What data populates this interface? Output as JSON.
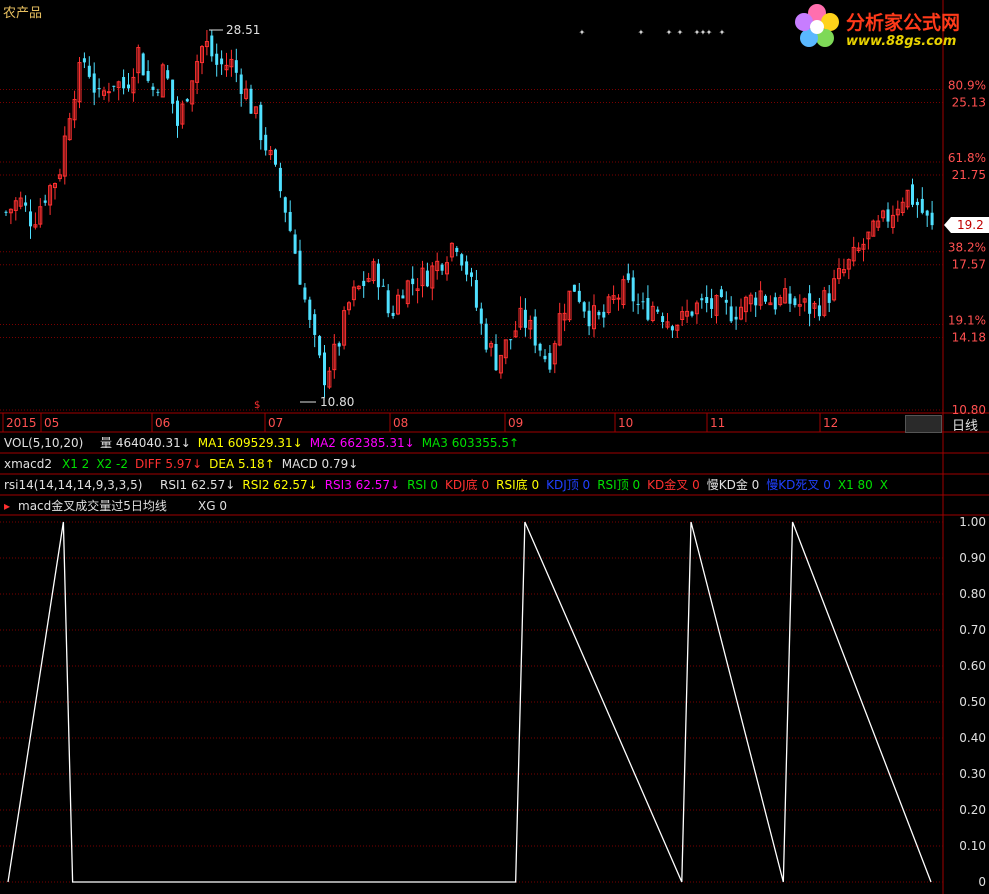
{
  "window": {
    "title": "农产品"
  },
  "logo": {
    "name": "分析家公式网",
    "url": "www.88gs.com"
  },
  "colors": {
    "bg": "#000000",
    "grid": "#7a0000",
    "axis": "#a00000",
    "up": "#ff3030",
    "down": "#4fe0ff",
    "white": "#ffffff",
    "yellow": "#ffff00",
    "magenta": "#ff00ff",
    "green": "#00e000",
    "red": "#ff3030",
    "blue": "#2040ff"
  },
  "price_axis": {
    "labels": [
      "25.13",
      "21.75",
      "17.57",
      "14.18",
      "10.80"
    ],
    "pct_labels": [
      "80.9%",
      "61.8%",
      "38.2%",
      "19.1%"
    ],
    "current_price": "19.2"
  },
  "annotations": {
    "high_label": "28.51",
    "low_label": "10.80",
    "marker": "$"
  },
  "date_axis": {
    "labels": [
      "2015",
      "05",
      "06",
      "07",
      "08",
      "09",
      "10",
      "11",
      "12"
    ],
    "period": "日线"
  },
  "vol_line": {
    "name": "VOL(5,10,20)",
    "items": [
      {
        "label": "量",
        "value": "464040.31↓",
        "color": "#e0e0e0"
      },
      {
        "label": "MA1",
        "value": "609529.31↓",
        "color": "#ffff00"
      },
      {
        "label": "MA2",
        "value": "662385.31↓",
        "color": "#ff00ff"
      },
      {
        "label": "MA3",
        "value": "603355.5↑",
        "color": "#00e000"
      }
    ]
  },
  "macd_line": {
    "name": "xmacd2",
    "items": [
      {
        "text": "X1 2",
        "color": "#00e000"
      },
      {
        "text": "X2 -2",
        "color": "#00e000"
      },
      {
        "text": "DIFF 5.97↓",
        "color": "#ff3030"
      },
      {
        "text": "DEA 5.18↑",
        "color": "#ffff00"
      },
      {
        "text": "MACD 0.79↓",
        "color": "#e0e0e0"
      }
    ]
  },
  "rsi_line": {
    "name": "rsi14(14,14,14,9,3,3,5)",
    "items": [
      {
        "text": "RSI1 62.57↓",
        "color": "#e0e0e0"
      },
      {
        "text": "RSI2 62.57↓",
        "color": "#ffff00"
      },
      {
        "text": "RSI3 62.57↓",
        "color": "#ff00ff"
      },
      {
        "text": "RSI 0",
        "color": "#00e000"
      },
      {
        "text": "KDJ底 0",
        "color": "#ff3030"
      },
      {
        "text": "RSI底 0",
        "color": "#ffff00"
      },
      {
        "text": "KDJ顶 0",
        "color": "#2040ff"
      },
      {
        "text": "RSI顶 0",
        "color": "#00e000"
      },
      {
        "text": "KD金叉 0",
        "color": "#ff3030"
      },
      {
        "text": "慢KD金 0",
        "color": "#e0e0e0"
      },
      {
        "text": "慢KD死叉 0",
        "color": "#2040ff"
      },
      {
        "text": "X1 80",
        "color": "#00e000"
      },
      {
        "text": "X",
        "color": "#00e000"
      }
    ]
  },
  "indicator_title": {
    "name": "macd金叉成交量过5日均线",
    "xg": "XG 0"
  },
  "chart_data": [
    {
      "type": "candlestick",
      "title": "农产品",
      "y_labels": [
        "25.13",
        "21.75",
        "17.57",
        "14.18",
        "10.80"
      ],
      "ylim": [
        10.8,
        28.51
      ],
      "x_labels": [
        "2015",
        "05",
        "06",
        "07",
        "08",
        "09",
        "10",
        "11",
        "12"
      ],
      "high": 28.51,
      "low": 10.8,
      "last": 19.2,
      "close_path": [
        20.0,
        20.6,
        19.6,
        20.9,
        21.8,
        25.5,
        27.2,
        25.2,
        26.2,
        25.8,
        27.5,
        25.6,
        26.7,
        24.0,
        26.4,
        28.0,
        26.8,
        27.0,
        25.8,
        24.2,
        22.5,
        20.5,
        17.8,
        14.6,
        12.3,
        13.6,
        15.9,
        16.7,
        17.4,
        15.1,
        16.6,
        16.8,
        17.2,
        17.9,
        18.8,
        17.0,
        14.5,
        13.1,
        14.0,
        15.1,
        14.2,
        13.0,
        15.5,
        16.6,
        15.3,
        14.9,
        16.0,
        16.5,
        15.4,
        15.7,
        15.1,
        14.9,
        15.6,
        15.7,
        15.5,
        15.4,
        15.8,
        16.3,
        15.8,
        15.9,
        15.7,
        15.5,
        16.0,
        17.0,
        17.8,
        18.7,
        19.3,
        20.1,
        21.0,
        20.3,
        19.2
      ]
    },
    {
      "type": "line",
      "title": "macd金叉成交量过5日均线",
      "series": [
        {
          "name": "XG",
          "values": [
            0,
            1,
            0,
            0,
            1,
            0,
            1,
            0,
            1,
            0
          ]
        }
      ],
      "x": [
        0.0,
        0.06,
        0.07,
        0.55,
        0.56,
        0.73,
        0.74,
        0.84,
        0.85,
        1.0
      ],
      "y_labels": [
        "1.00",
        "0.90",
        "0.80",
        "0.70",
        "0.60",
        "0.50",
        "0.40",
        "0.30",
        "0.20",
        "0.10",
        "0"
      ],
      "ylim": [
        0,
        1
      ]
    }
  ]
}
